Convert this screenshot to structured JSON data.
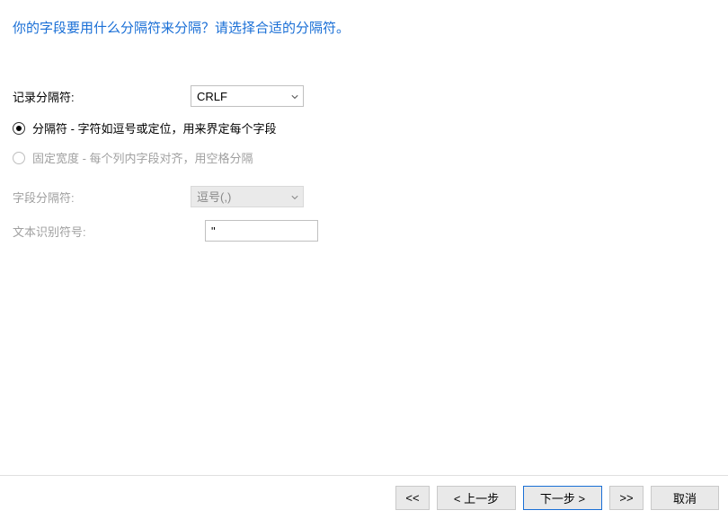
{
  "title": "你的字段要用什么分隔符来分隔？请选择合适的分隔符。",
  "recordSep": {
    "label": "记录分隔符:",
    "value": "CRLF",
    "options": [
      "CRLF"
    ]
  },
  "radios": {
    "delimiter": {
      "label": "分隔符 - 字符如逗号或定位，用来界定每个字段",
      "selected": true
    },
    "fixed": {
      "label": "固定宽度 - 每个列内字段对齐，用空格分隔",
      "selected": false,
      "disabled": true
    }
  },
  "fieldSep": {
    "label": "字段分隔符:",
    "value": "逗号(,)",
    "options": [
      "逗号(,)"
    ],
    "disabled": true
  },
  "textQualifier": {
    "label": "文本识别符号:",
    "value": "\"",
    "disabled": true
  },
  "buttons": {
    "first": "<<",
    "prev": "< 上一步",
    "next": "下一步 >",
    "last": ">>",
    "cancel": "取消"
  }
}
